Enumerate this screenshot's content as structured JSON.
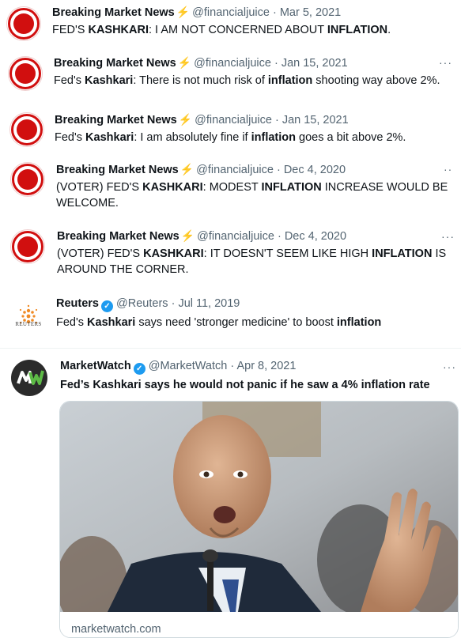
{
  "tweets": [
    {
      "name": "Breaking Market News",
      "handle": "@financialjuice",
      "date": "Mar 5, 2021",
      "body": [
        {
          "t": "FED'S ",
          "b": false
        },
        {
          "t": "KASHKARI",
          "b": true
        },
        {
          "t": ": I AM NOT CONCERNED ABOUT ",
          "b": false
        },
        {
          "t": "INFLATION",
          "b": true
        },
        {
          "t": ".",
          "b": false
        }
      ]
    },
    {
      "name": "Breaking Market News",
      "handle": "@financialjuice",
      "date": "Jan 15, 2021",
      "more": "···",
      "body": [
        {
          "t": "Fed's ",
          "b": false
        },
        {
          "t": "Kashkari",
          "b": true
        },
        {
          "t": ": There is not much risk of ",
          "b": false
        },
        {
          "t": "inflation",
          "b": true
        },
        {
          "t": " shooting way above 2%.",
          "b": false
        }
      ]
    },
    {
      "name": "Breaking Market News",
      "handle": "@financialjuice",
      "date": "Jan 15, 2021",
      "body": [
        {
          "t": "Fed's ",
          "b": false
        },
        {
          "t": "Kashkari",
          "b": true
        },
        {
          "t": ": I am absolutely fine if ",
          "b": false
        },
        {
          "t": "inflation",
          "b": true
        },
        {
          "t": " goes a bit above 2%.",
          "b": false
        }
      ]
    },
    {
      "name": "Breaking Market News",
      "handle": "@financialjuice",
      "date": "Dec 4, 2020",
      "more": "··",
      "body": [
        {
          "t": "(VOTER) FED'S ",
          "b": false
        },
        {
          "t": "KASHKARI",
          "b": true
        },
        {
          "t": ": MODEST ",
          "b": false
        },
        {
          "t": "INFLATION",
          "b": true
        },
        {
          "t": " INCREASE WOULD BE WELCOME.",
          "b": false
        }
      ]
    },
    {
      "name": "Breaking Market News",
      "handle": "@financialjuice",
      "date": "Dec 4, 2020",
      "more": "···",
      "body": [
        {
          "t": "(VOTER) FED'S ",
          "b": false
        },
        {
          "t": "KASHKARI",
          "b": true
        },
        {
          "t": ": IT DOESN'T SEEM LIKE HIGH ",
          "b": false
        },
        {
          "t": "INFLATION",
          "b": true
        },
        {
          "t": " IS AROUND THE CORNER.",
          "b": false
        }
      ]
    },
    {
      "name": "Reuters",
      "handle": "@Reuters",
      "date": "Jul 11, 2019",
      "verified": true,
      "avatar_text": "REUTERS",
      "body": [
        {
          "t": "Fed's ",
          "b": false
        },
        {
          "t": "Kashkari",
          "b": true
        },
        {
          "t": " says need 'stronger medicine' to boost ",
          "b": false
        },
        {
          "t": "inflation",
          "b": true
        }
      ]
    },
    {
      "name": "MarketWatch",
      "handle": "@MarketWatch",
      "date": "Apr 8, 2021",
      "verified": true,
      "more": "···",
      "avatar_text": "MW",
      "headline": "Fed’s Kashkari says he would not panic if he saw a 4% inflation rate",
      "card_domain": "marketwatch.com"
    }
  ],
  "sep": "·",
  "bolt": "⚡"
}
